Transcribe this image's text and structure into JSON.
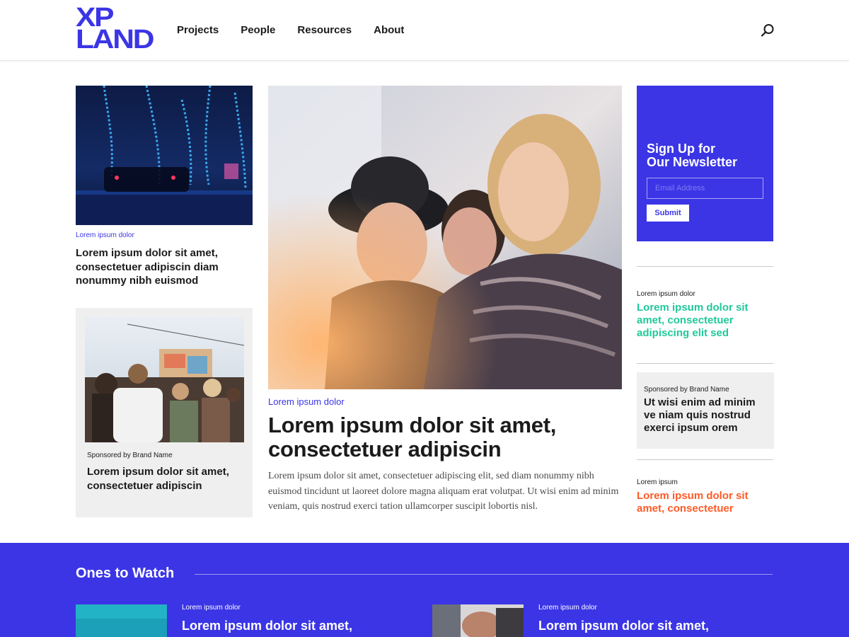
{
  "brand": {
    "logo_line1": "XP",
    "logo_line2": "LAND",
    "accent": "#3b35e6",
    "teal": "#1fc99a",
    "orange": "#ff5a26"
  },
  "nav": {
    "items": [
      "Projects",
      "People",
      "Resources",
      "About"
    ],
    "search_icon": "search-icon"
  },
  "left": {
    "top_story": {
      "image": "night-street-neon-lights-photo",
      "kicker": "Lorem ipsum dolor",
      "headline": "Lorem ipsum dolor sit amet, consectetuer adipiscin diam nonummy nibh euismod"
    },
    "sponsored": {
      "image": "festival-crowd-stage-photo",
      "label": "Sponsored by Brand Name",
      "headline": "Lorem ipsum dolor sit amet, consectetuer adipiscin"
    }
  },
  "hero": {
    "image": "friends-laughing-outdoors-photo",
    "kicker": "Lorem ipsum dolor",
    "headline": "Lorem ipsum dolor sit amet, consectetuer adipiscin",
    "body": "Lorem ipsum dolor sit amet, consectetuer adipiscing elit, sed diam nonummy nibh euismod tincidunt ut laoreet dolore magna aliquam erat volutpat. Ut wisi enim ad minim veniam, quis nostrud exerci tation ullamcorper suscipit lobortis nisl."
  },
  "newsletter": {
    "title_line1": "Sign Up for",
    "title_line2": "Our Newsletter",
    "placeholder": "Email Address",
    "submit": "Submit"
  },
  "side": {
    "story1": {
      "kicker": "Lorem ipsum dolor",
      "headline": "Lorem ipsum dolor sit amet, consectetuer adipiscing elit sed"
    },
    "sponsored": {
      "label": "Sponsored by Brand Name",
      "headline": "Ut wisi enim ad minim ve niam quis nostrud exerci ipsum orem"
    },
    "story2": {
      "kicker": "Lorem ipsum",
      "headline": "Lorem ipsum dolor sit amet, consectetuer"
    }
  },
  "watch": {
    "title": "Ones to Watch",
    "items": [
      {
        "image": "teal-abstract-photo",
        "kicker": "Lorem ipsum dolor",
        "headline": "Lorem ipsum dolor sit amet,"
      },
      {
        "image": "hands-camera-photo",
        "kicker": "Lorem ipsum dolor",
        "headline": "Lorem ipsum dolor sit amet,"
      }
    ]
  }
}
